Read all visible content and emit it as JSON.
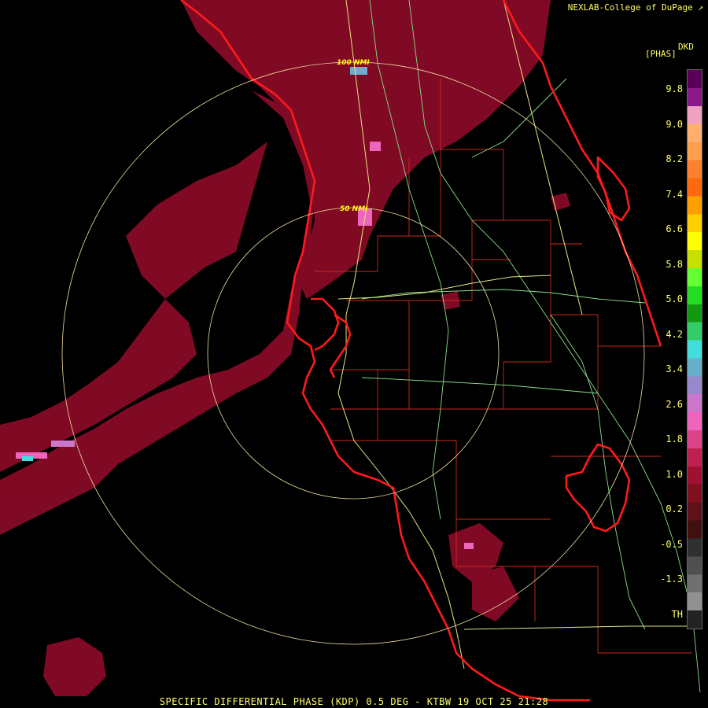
{
  "header": {
    "credit": "NEXLAB-College of DuPage",
    "product_code": "DKD",
    "unit": "[PHAS]"
  },
  "legend": {
    "ticks": [
      "9.8",
      "9.0",
      "8.2",
      "7.4",
      "6.6",
      "5.8",
      "5.0",
      "4.2",
      "3.4",
      "2.6",
      "1.8",
      "1.0",
      "0.2",
      "-0.5",
      "-1.3",
      "TH"
    ],
    "colors": [
      "#5a005a",
      "#8a1a8a",
      "#f0a0c0",
      "#ffb070",
      "#ffa050",
      "#ff8030",
      "#ff6a10",
      "#ff9f00",
      "#ffd000",
      "#ffff00",
      "#c8e000",
      "#66ff33",
      "#22dd22",
      "#119911",
      "#33cc66",
      "#44dddd",
      "#66b0cc",
      "#9988cc",
      "#cc77cc",
      "#ee66bb",
      "#dd4488",
      "#c02050",
      "#a01030",
      "#801020",
      "#601018",
      "#401010",
      "#303030",
      "#505050",
      "#707070",
      "#909090",
      "#222222"
    ]
  },
  "map": {
    "range_rings": [
      "50 NMI",
      "100 NMI"
    ],
    "colors": {
      "coast": "#ff1a1a",
      "county": "#cc2a1a",
      "highway": "#e6e680",
      "road": "#88dd88",
      "ring": "#f0e0a0",
      "echo": "#8b0b28"
    }
  },
  "footer": {
    "caption": "SPECIFIC DIFFERENTIAL PHASE (KDP) 0.5 DEG - KTBW 19 OCT 25 21:28"
  }
}
